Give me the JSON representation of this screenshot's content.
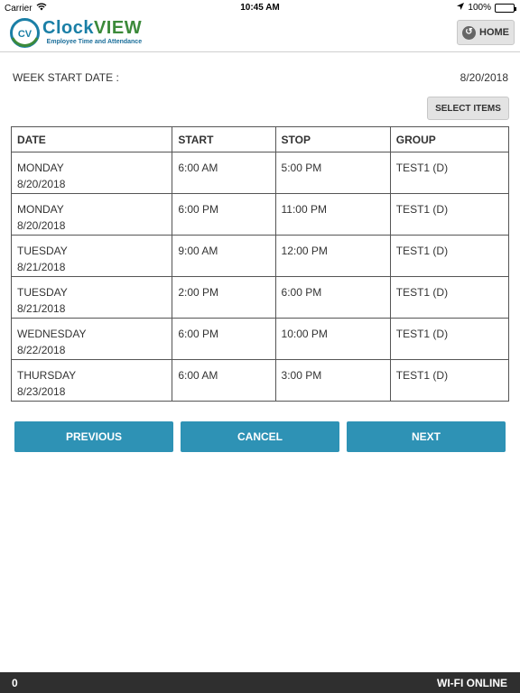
{
  "status_bar": {
    "carrier": "Carrier",
    "time": "10:45 AM",
    "battery": "100%",
    "battery_level": 1.0
  },
  "header": {
    "logo_badge": "CV",
    "logo_clock": "Clock",
    "logo_view": "VIEW",
    "logo_subtitle": "Employee Time and Attendance",
    "home_label": "HOME"
  },
  "week": {
    "label": "WEEK START DATE :",
    "date": "8/20/2018",
    "select_items_label": "SELECT ITEMS"
  },
  "table": {
    "headers": [
      "DATE",
      "START",
      "STOP",
      "GROUP"
    ],
    "rows": [
      {
        "day": "MONDAY",
        "date": "8/20/2018",
        "start": "6:00 AM",
        "stop": "5:00 PM",
        "group": "TEST1 (D)"
      },
      {
        "day": "MONDAY",
        "date": "8/20/2018",
        "start": "6:00 PM",
        "stop": "11:00 PM",
        "group": "TEST1 (D)"
      },
      {
        "day": "TUESDAY",
        "date": "8/21/2018",
        "start": "9:00 AM",
        "stop": "12:00 PM",
        "group": "TEST1 (D)"
      },
      {
        "day": "TUESDAY",
        "date": "8/21/2018",
        "start": "2:00 PM",
        "stop": "6:00 PM",
        "group": "TEST1 (D)"
      },
      {
        "day": "WEDNESDAY",
        "date": "8/22/2018",
        "start": "6:00 PM",
        "stop": "10:00 PM",
        "group": "TEST1 (D)"
      },
      {
        "day": "THURSDAY",
        "date": "8/23/2018",
        "start": "6:00 AM",
        "stop": "3:00 PM",
        "group": "TEST1 (D)"
      }
    ]
  },
  "actions": {
    "previous": "PREVIOUS",
    "cancel": "CANCEL",
    "next": "NEXT"
  },
  "footer": {
    "count": "0",
    "wifi_status": "WI-FI ONLINE"
  },
  "colors": {
    "accent": "#2e92b5",
    "footer_bg": "#2f2f2f",
    "logo_blue": "#1a7fa6",
    "logo_green": "#3c8a3a"
  },
  "icons": {
    "wifi": "wifi-icon",
    "location": "location-arrow-icon",
    "battery": "battery-icon",
    "home": "home-back-icon"
  }
}
